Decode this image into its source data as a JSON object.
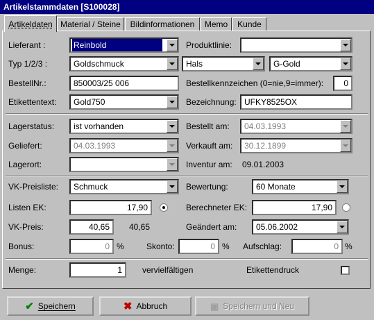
{
  "window": {
    "title": "Artikelstammdaten [S100028]"
  },
  "tabs": [
    {
      "label": "Artikeldaten"
    },
    {
      "label": "Material / Steine"
    },
    {
      "label": "Bildinformationen"
    },
    {
      "label": "Memo"
    },
    {
      "label": "Kunde"
    }
  ],
  "form": {
    "lieferant": {
      "label": "Lieferant :",
      "value": "Reinbold"
    },
    "produktlinie": {
      "label": "Produktlinie:",
      "value": ""
    },
    "typ": {
      "label": "Typ 1/2/3 :",
      "value1": "Goldschmuck",
      "value2": "Hals",
      "value3": "G-Gold"
    },
    "bestellnr": {
      "label": "BestellNr.:",
      "value": "850003/25 006"
    },
    "bestellkennzeichen": {
      "label": "Bestellkennzeichen (0=nie,9=immer):",
      "value": "0"
    },
    "etikettentext": {
      "label": "Etikettentext:",
      "value": "Gold750"
    },
    "bezeichnung": {
      "label": "Bezeichnung:",
      "value": "UFKY8525OX"
    },
    "lagerstatus": {
      "label": "Lagerstatus:",
      "value": "ist vorhanden"
    },
    "bestellt_am": {
      "label": "Bestellt am:",
      "value": "04.03.1993"
    },
    "geliefert": {
      "label": "Geliefert:",
      "value": "04.03.1993"
    },
    "verkauft_am": {
      "label": "Verkauft am:",
      "value": "30.12.1899"
    },
    "lagerort": {
      "label": "Lagerort:",
      "value": ""
    },
    "inventur": {
      "label": "Inventur am:",
      "value": "09.01.2003"
    },
    "vk_preisliste": {
      "label": "VK-Preisliste:",
      "value": "Schmuck"
    },
    "bewertung": {
      "label": "Bewertung:",
      "value": "60 Monate"
    },
    "listen_ek": {
      "label": "Listen EK:",
      "value": "17,90",
      "selected": true
    },
    "berechneter_ek": {
      "label": "Berechneter EK:",
      "value": "17,90",
      "selected": false
    },
    "vk_preis": {
      "label": "VK-Preis:",
      "value": "40,65",
      "display": "40,65"
    },
    "geaendert_am": {
      "label": "Geändert am:",
      "value": "05.06.2002"
    },
    "bonus": {
      "label": "Bonus:",
      "value": "0",
      "unit": "%"
    },
    "skonto": {
      "label": "Skonto:",
      "value": "0",
      "unit": "%"
    },
    "aufschlag": {
      "label": "Aufschlag:",
      "value": "0",
      "unit": "%"
    },
    "menge": {
      "label": "Menge:",
      "value": "1"
    },
    "vervielfaeltigen": {
      "label": "vervielfältigen"
    },
    "etikettendruck": {
      "label": "Etikettendruck",
      "checked": false
    }
  },
  "buttons": {
    "save": "Speichern",
    "cancel": "Abbruch",
    "save_new": "Speichern und Neu"
  },
  "colors": {
    "titlebar": "#000080",
    "face": "#c0c0c0",
    "save_icon": "#008000",
    "cancel_icon": "#c00000"
  }
}
